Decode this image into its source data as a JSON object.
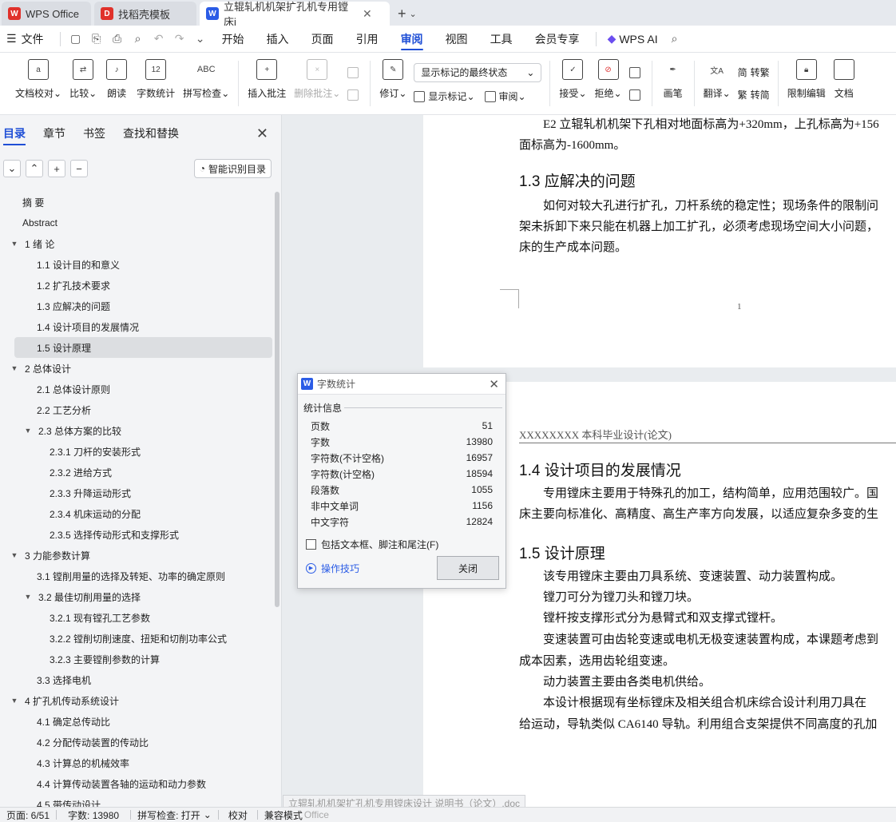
{
  "tabs": [
    {
      "label": "WPS Office",
      "color": "#e0312b",
      "glyph": "W"
    },
    {
      "label": "找稻壳模板",
      "color": "#e0312b",
      "glyph": "D"
    },
    {
      "label": "立辊轧机机架扩孔机专用镗床i",
      "color": "#2b5ce6",
      "glyph": "W"
    }
  ],
  "menubar": {
    "file": "文件",
    "items": [
      "开始",
      "插入",
      "页面",
      "引用",
      "审阅",
      "视图",
      "工具",
      "会员专享"
    ],
    "active_index": 4,
    "wps_ai": "WPS AI"
  },
  "ribbon": {
    "proofread": "文档校对",
    "compare": "比较",
    "read_aloud": "朗读",
    "word_count": "字数统计",
    "spell_check": "拼写检查",
    "insert_comment": "插入批注",
    "delete_comment": "删除批注",
    "revise": "修订",
    "markup_dropdown": "显示标记的最终状态",
    "show_markup": "显示标记",
    "review": "审阅",
    "accept": "接受",
    "reject": "拒绝",
    "pen": "画笔",
    "translate": "翻译",
    "to_traditional": "转繁",
    "to_simplified": "转简",
    "restrict_edit": "限制编辑",
    "doc_cut": "文档"
  },
  "left_panel": {
    "tabs": [
      "目录",
      "章节",
      "书签",
      "查找和替换"
    ],
    "smart_button": "智能识别目录",
    "toc": [
      {
        "label": "摘  要",
        "level": 0,
        "arrow": ""
      },
      {
        "label": "Abstract",
        "level": 0,
        "arrow": ""
      },
      {
        "label": "1   绪  论",
        "level": 0,
        "arrow": "▼"
      },
      {
        "label": "1.1  设计目的和意义",
        "level": 1,
        "arrow": ""
      },
      {
        "label": "1.2  扩孔技术要求",
        "level": 1,
        "arrow": ""
      },
      {
        "label": "1.3  应解决的问题",
        "level": 1,
        "arrow": ""
      },
      {
        "label": "1.4  设计项目的发展情况",
        "level": 1,
        "arrow": ""
      },
      {
        "label": "1.5 设计原理",
        "level": 1,
        "arrow": "",
        "selected": true
      },
      {
        "label": "2    总体设计",
        "level": 0,
        "arrow": "▼"
      },
      {
        "label": "2.1  总体设计原则",
        "level": 1,
        "arrow": ""
      },
      {
        "label": "2.2  工艺分析",
        "level": 1,
        "arrow": ""
      },
      {
        "label": "2.3  总体方案的比较",
        "level": 1,
        "arrow": "▼"
      },
      {
        "label": "2.3.1  刀杆的安装形式",
        "level": 2,
        "arrow": ""
      },
      {
        "label": "2.3.2  进给方式",
        "level": 2,
        "arrow": ""
      },
      {
        "label": "2.3.3  升降运动形式",
        "level": 2,
        "arrow": ""
      },
      {
        "label": "2.3.4  机床运动的分配",
        "level": 2,
        "arrow": ""
      },
      {
        "label": "2.3.5  选择传动形式和支撑形式",
        "level": 2,
        "arrow": ""
      },
      {
        "label": "3    力能参数计算",
        "level": 0,
        "arrow": "▼"
      },
      {
        "label": "3.1  镗削用量的选择及转矩、功率的确定原则",
        "level": 1,
        "arrow": ""
      },
      {
        "label": "3.2  最佳切削用量的选择",
        "level": 1,
        "arrow": "▼"
      },
      {
        "label": "3.2.1  现有镗孔工艺参数",
        "level": 2,
        "arrow": ""
      },
      {
        "label": "3.2.2  镗削切削速度、扭矩和切削功率公式",
        "level": 2,
        "arrow": ""
      },
      {
        "label": "3.2.3  主要镗削参数的计算",
        "level": 2,
        "arrow": ""
      },
      {
        "label": "3.3  选择电机",
        "level": 1,
        "arrow": ""
      },
      {
        "label": "4    扩孔机传动系统设计",
        "level": 0,
        "arrow": "▼"
      },
      {
        "label": "4.1  确定总传动比",
        "level": 1,
        "arrow": ""
      },
      {
        "label": "4.2  分配传动装置的传动比",
        "level": 1,
        "arrow": ""
      },
      {
        "label": "4.3  计算总的机械效率",
        "level": 1,
        "arrow": ""
      },
      {
        "label": "4.4  计算传动装置各轴的运动和动力参数",
        "level": 1,
        "arrow": ""
      },
      {
        "label": "4.5  带传动设计",
        "level": 1,
        "arrow": ""
      }
    ]
  },
  "page1": {
    "lines": [
      "E2 立辊轧机机架下孔相对地面标高为+320mm，上孔标高为+156",
      "面标高为-1600mm。",
      "1.3  应解决的问题",
      "如何对较大孔进行扩孔，刀杆系统的稳定性；现场条件的限制问",
      "架未拆卸下来只能在机器上加工扩孔，必须考虑现场空间大小问题，",
      "床的生产成本问题。"
    ],
    "page_number": "1"
  },
  "page2": {
    "header": "XXXXXXXX 本科毕业设计(论文)",
    "lines": [
      "1.4  设计项目的发展情况",
      "专用镗床主要用于特殊孔的加工，结构简单，应用范围较广。国",
      "床主要向标准化、高精度、高生产率方向发展，以适应复杂多变的生",
      "1.5 设计原理",
      "该专用镗床主要由刀具系统、变速装置、动力装置构成。",
      "镗刀可分为镗刀头和镗刀块。",
      "镗杆按支撑形式分为悬臂式和双支撑式镗杆。",
      "变速装置可由齿轮变速或电机无极变速装置构成，本课题考虑到",
      "成本因素，选用齿轮组变速。",
      "动力装置主要由各类电机供给。",
      "本设计根据现有坐标镗床及相关组合机床综合设计利用刀具在",
      "给运动，导轨类似 CA6140 导轨。利用组合支架提供不同高度的孔加"
    ]
  },
  "dialog": {
    "title": "字数统计",
    "section": "统计信息",
    "rows": [
      {
        "label": "页数",
        "value": "51"
      },
      {
        "label": "字数",
        "value": "13980"
      },
      {
        "label": "字符数(不计空格)",
        "value": "16957"
      },
      {
        "label": "字符数(计空格)",
        "value": "18594"
      },
      {
        "label": "段落数",
        "value": "1055"
      },
      {
        "label": "非中文单词",
        "value": "1156"
      },
      {
        "label": "中文字符",
        "value": "12824"
      }
    ],
    "checkbox": "包括文本框、脚注和尾注(F)",
    "tips": "操作技巧",
    "close": "关闭"
  },
  "statusbar": {
    "page": "页面: 6/51",
    "words": "字数: 13980",
    "spell": "拼写检查: 打开",
    "proof": "校对",
    "compat": "兼容模式",
    "tooltip": "立辊轧机机架扩孔机专用镗床设计 说明书（论文）.doc",
    "tooltip_tail": "Office"
  }
}
